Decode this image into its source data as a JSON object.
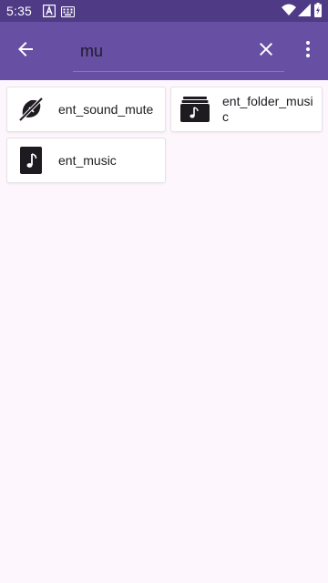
{
  "status_bar": {
    "time": "5:35",
    "icons": [
      "text-a-notification-icon",
      "keyboard-icon",
      "wifi-icon",
      "cell-signal-icon",
      "battery-charging-icon"
    ]
  },
  "app_bar": {
    "back_icon": "arrow-back-icon",
    "search": {
      "value": "mu",
      "placeholder": ""
    },
    "clear_icon": "close-icon",
    "menu_icon": "more-vert-icon"
  },
  "results": [
    {
      "label": "ent_sound_mute",
      "icon": "sound-mute-icon"
    },
    {
      "label": "ent_folder_music",
      "icon": "folder-music-icon"
    },
    {
      "label": "ent_music",
      "icon": "music-file-icon"
    }
  ],
  "colors": {
    "app_bar": "#6750a4",
    "status_bar": "#4f3a86",
    "background": "#fdf6fd",
    "card": "#ffffff",
    "icon": "#1d1b20"
  }
}
